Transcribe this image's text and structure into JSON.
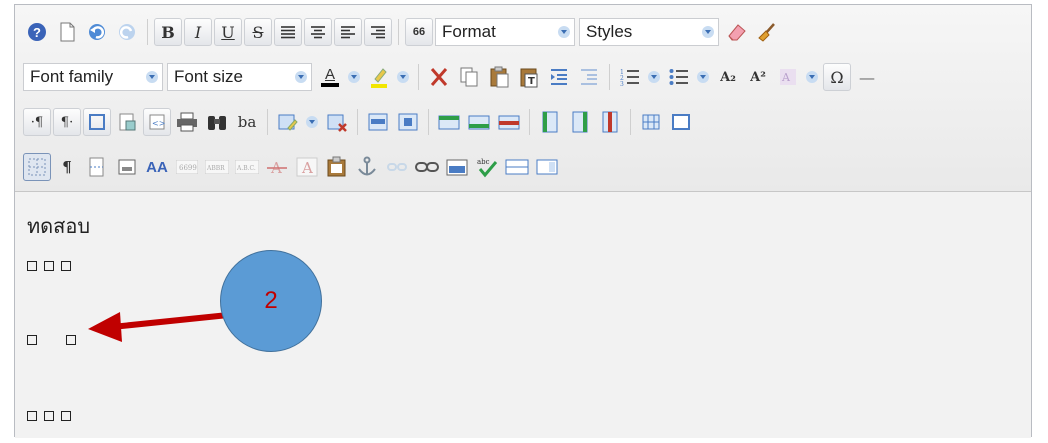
{
  "toolbar": {
    "row1": {
      "help_label": "?",
      "bold_label": "B",
      "italic_label": "I",
      "underline_label": "U",
      "strike_label": "S",
      "blockquote_label": "66",
      "format_label": "Format",
      "styles_label": "Styles"
    },
    "row2": {
      "font_family_label": "Font family",
      "font_size_label": "Font size",
      "font_color_label": "A",
      "subscript_label": "A₂",
      "superscript_label": "A²",
      "omega_label": "Ω",
      "hr_label": "—"
    },
    "row3": {
      "ltr_label": "·¶",
      "rtl_label": "¶·",
      "ba_label": "ba"
    },
    "row4": {
      "pilcrow_label": "¶",
      "styles_icon_label": "AA"
    }
  },
  "content": {
    "heading_text": "ทดสอบ",
    "callout_number": "2"
  },
  "colors": {
    "circle_fill": "#5b9bd5",
    "arrow": "#c00000"
  }
}
